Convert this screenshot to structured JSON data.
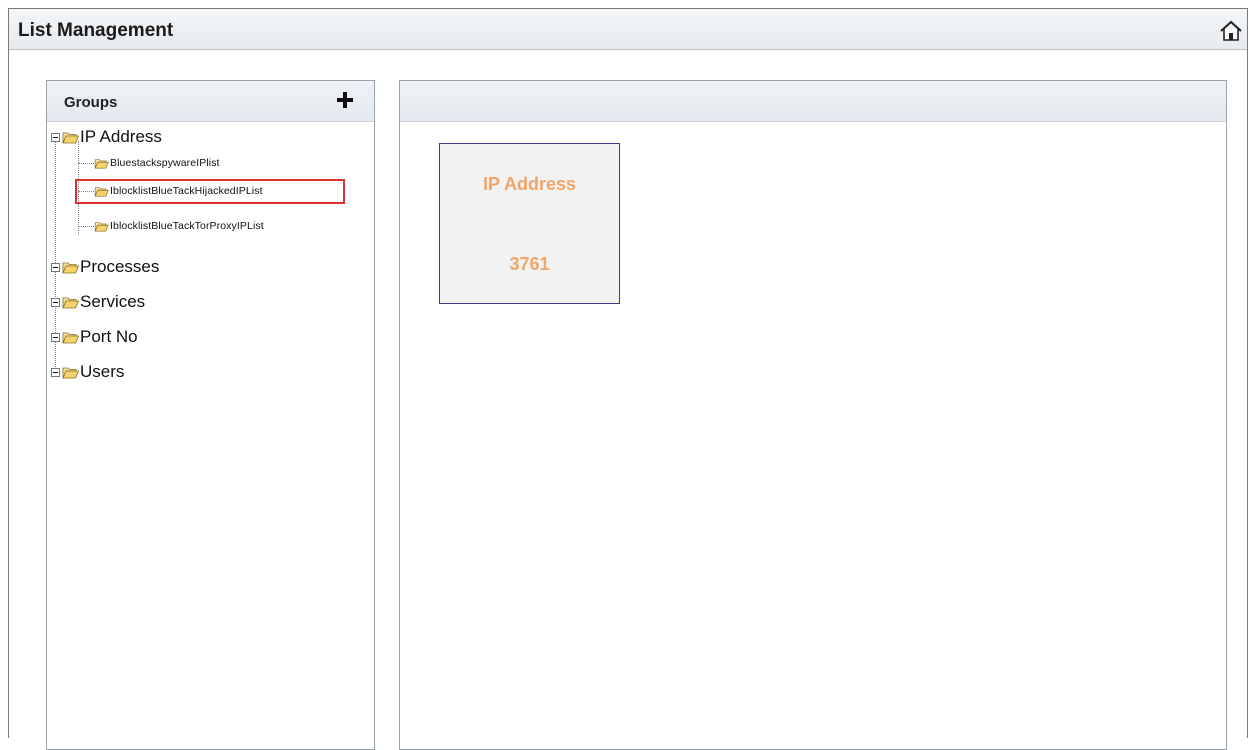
{
  "window": {
    "title": "List Management",
    "home_icon": "home-icon"
  },
  "sidebar": {
    "header": "Groups",
    "add_icon": "plus-icon",
    "tree": [
      {
        "label": "IP Address",
        "expanded": true,
        "children": [
          {
            "label": "BluestackspywareIPlist"
          },
          {
            "label": "IblocklistBlueTackHijackedIPList",
            "highlighted": true
          },
          {
            "label": "IblocklistBlueTackTorProxyIPList"
          }
        ]
      },
      {
        "label": "Processes"
      },
      {
        "label": "Services"
      },
      {
        "label": "Port No"
      },
      {
        "label": "Users"
      }
    ]
  },
  "main": {
    "tile": {
      "title": "IP Address",
      "count": "3761"
    }
  },
  "colors": {
    "tile_text": "#f0a66a",
    "tile_border": "#3c3a8c",
    "highlight_border": "#e0312f",
    "header_bg": "#e7ebef"
  }
}
